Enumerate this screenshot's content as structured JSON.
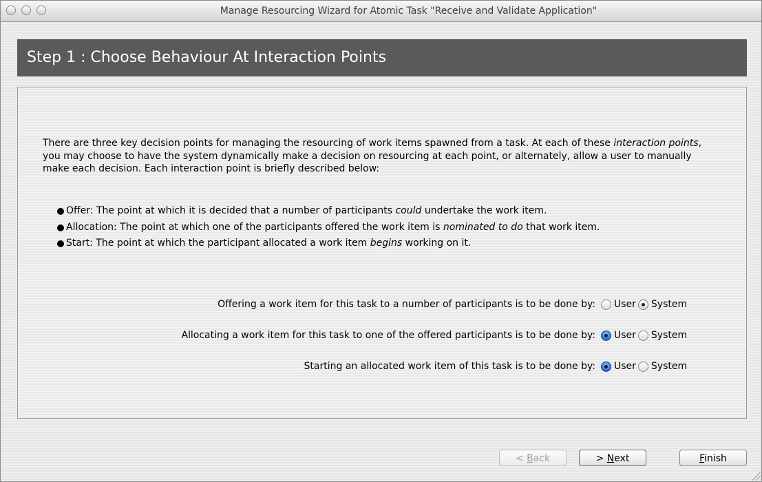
{
  "window": {
    "title": "Manage Resourcing Wizard for Atomic Task \"Receive and Validate Application\""
  },
  "step": {
    "title": "Step 1 : Choose Behaviour At Interaction Points"
  },
  "intro": {
    "part1": "There are three key decision points for managing the resourcing of work items spawned from a task. At each of these ",
    "emphasis": "interaction points",
    "part2": ", you may choose to have the system dynamically make a decision on resourcing at each point, or alternately, allow a user to manually make each decision. Each interaction point is briefly described below:"
  },
  "bullets": [
    {
      "before": "Offer: The point at which it is decided that a number of participants ",
      "emphasis": "could",
      "after": " undertake the work item."
    },
    {
      "before": "Allocation: The point at which one of the participants offered the work item is ",
      "emphasis": "nominated to do",
      "after": " that work item."
    },
    {
      "before": "Start: The point at which the participant allocated a work item ",
      "emphasis": "begins",
      "after": " working on it."
    }
  ],
  "questions": [
    {
      "label": "Offering a work item for this task to a number of participants is to be done by:",
      "options": [
        "User",
        "System"
      ],
      "selected": "System"
    },
    {
      "label": "Allocating a work item for this task to one of the offered participants is to be done by:",
      "options": [
        "User",
        "System"
      ],
      "selected": "User"
    },
    {
      "label": "Starting an allocated work item of this task is to be done by:",
      "options": [
        "User",
        "System"
      ],
      "selected": "User"
    }
  ],
  "buttons": {
    "back": {
      "prefix": "< ",
      "mnemonic": "B",
      "rest": "ack",
      "enabled": false
    },
    "next": {
      "prefix": "> ",
      "mnemonic": "N",
      "rest": "ext",
      "enabled": true
    },
    "finish": {
      "prefix": "",
      "mnemonic": "F",
      "rest": "inish",
      "enabled": true
    }
  },
  "icons": {
    "close": "close-icon",
    "minimize": "minimize-icon",
    "zoom": "zoom-icon",
    "bullet": "bullet-dot-icon",
    "resize": "resize-grip-icon"
  },
  "colors": {
    "header_bg": "#5a5a5a",
    "header_text": "#ffffff",
    "selected_radio": "#2c6fd6"
  }
}
